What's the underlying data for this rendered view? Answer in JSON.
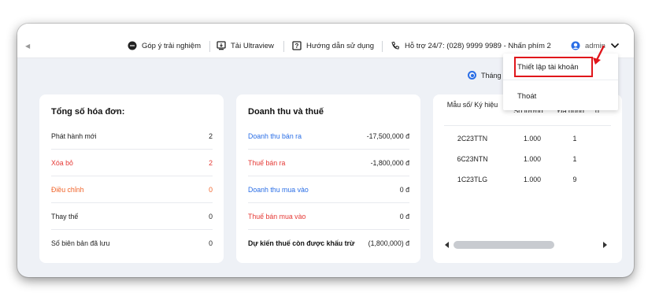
{
  "topbar": {
    "feedback": "Góp ý trải nghiệm",
    "ultraview": "Tải Ultraview",
    "guide": "Hướng dẫn sử dụng",
    "support": "Hỗ trợ 24/7: (028) 9999 9989 - Nhấn phím 2",
    "user": "admin"
  },
  "dropdown": {
    "items": [
      "Thiết lập tài khoản",
      "Thoát"
    ]
  },
  "period": {
    "selected_label": "Tháng"
  },
  "invoices": {
    "title": "Tổng số hóa đơn:",
    "rows": [
      {
        "label": "Phát hành mới",
        "value": "2"
      },
      {
        "label": "Xóa bỏ",
        "value": "2"
      },
      {
        "label": "Điều chỉnh",
        "value": "0"
      },
      {
        "label": "Thay thế",
        "value": "0"
      },
      {
        "label": "Số biên bản đã lưu",
        "value": "0"
      }
    ]
  },
  "revenue": {
    "title": "Doanh thu và thuế",
    "rows": [
      {
        "label": "Doanh thu bán ra",
        "value": "-17,500,000 đ"
      },
      {
        "label": "Thuế bán ra",
        "value": "-1,800,000 đ"
      },
      {
        "label": "Doanh thu mua vào",
        "value": "0 đ"
      },
      {
        "label": "Thuế bán mua vào",
        "value": "0 đ"
      },
      {
        "label": "Dự kiến thuế còn được khấu trừ",
        "value": "(1,800,000) đ"
      }
    ]
  },
  "templates": {
    "headers": [
      "Mẫu số/ Ký hiệu",
      "Số lượng",
      "Đã dùng"
    ],
    "rows": [
      {
        "code": "2C23TTN",
        "qty": "1.000",
        "used": "1"
      },
      {
        "code": "6C23NTN",
        "qty": "1.000",
        "used": "1"
      },
      {
        "code": "1C23TLG",
        "qty": "1.000",
        "used": "9"
      }
    ]
  },
  "colors": {
    "accent_red": "#e0161b",
    "link_blue": "#2a6ee6",
    "row_red": "#e53935",
    "row_orange": "#f0642a"
  }
}
